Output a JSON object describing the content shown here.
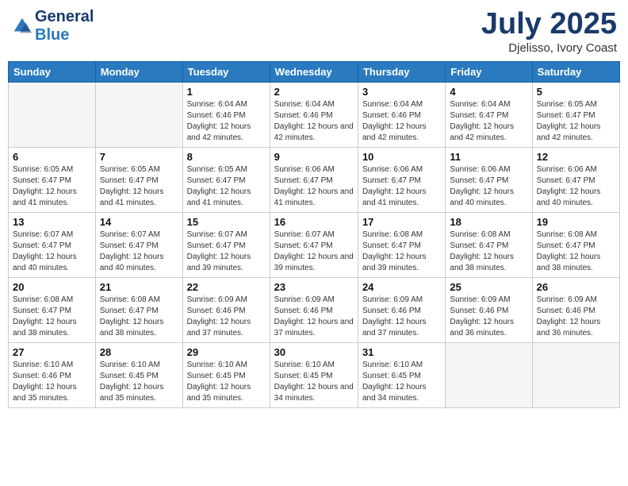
{
  "header": {
    "logo_line1": "General",
    "logo_line2": "Blue",
    "month_title": "July 2025",
    "subtitle": "Djelisso, Ivory Coast"
  },
  "days_of_week": [
    "Sunday",
    "Monday",
    "Tuesday",
    "Wednesday",
    "Thursday",
    "Friday",
    "Saturday"
  ],
  "weeks": [
    [
      {
        "day": "",
        "info": ""
      },
      {
        "day": "",
        "info": ""
      },
      {
        "day": "1",
        "info": "Sunrise: 6:04 AM\nSunset: 6:46 PM\nDaylight: 12 hours and 42 minutes."
      },
      {
        "day": "2",
        "info": "Sunrise: 6:04 AM\nSunset: 6:46 PM\nDaylight: 12 hours and 42 minutes."
      },
      {
        "day": "3",
        "info": "Sunrise: 6:04 AM\nSunset: 6:46 PM\nDaylight: 12 hours and 42 minutes."
      },
      {
        "day": "4",
        "info": "Sunrise: 6:04 AM\nSunset: 6:47 PM\nDaylight: 12 hours and 42 minutes."
      },
      {
        "day": "5",
        "info": "Sunrise: 6:05 AM\nSunset: 6:47 PM\nDaylight: 12 hours and 42 minutes."
      }
    ],
    [
      {
        "day": "6",
        "info": "Sunrise: 6:05 AM\nSunset: 6:47 PM\nDaylight: 12 hours and 41 minutes."
      },
      {
        "day": "7",
        "info": "Sunrise: 6:05 AM\nSunset: 6:47 PM\nDaylight: 12 hours and 41 minutes."
      },
      {
        "day": "8",
        "info": "Sunrise: 6:05 AM\nSunset: 6:47 PM\nDaylight: 12 hours and 41 minutes."
      },
      {
        "day": "9",
        "info": "Sunrise: 6:06 AM\nSunset: 6:47 PM\nDaylight: 12 hours and 41 minutes."
      },
      {
        "day": "10",
        "info": "Sunrise: 6:06 AM\nSunset: 6:47 PM\nDaylight: 12 hours and 41 minutes."
      },
      {
        "day": "11",
        "info": "Sunrise: 6:06 AM\nSunset: 6:47 PM\nDaylight: 12 hours and 40 minutes."
      },
      {
        "day": "12",
        "info": "Sunrise: 6:06 AM\nSunset: 6:47 PM\nDaylight: 12 hours and 40 minutes."
      }
    ],
    [
      {
        "day": "13",
        "info": "Sunrise: 6:07 AM\nSunset: 6:47 PM\nDaylight: 12 hours and 40 minutes."
      },
      {
        "day": "14",
        "info": "Sunrise: 6:07 AM\nSunset: 6:47 PM\nDaylight: 12 hours and 40 minutes."
      },
      {
        "day": "15",
        "info": "Sunrise: 6:07 AM\nSunset: 6:47 PM\nDaylight: 12 hours and 39 minutes."
      },
      {
        "day": "16",
        "info": "Sunrise: 6:07 AM\nSunset: 6:47 PM\nDaylight: 12 hours and 39 minutes."
      },
      {
        "day": "17",
        "info": "Sunrise: 6:08 AM\nSunset: 6:47 PM\nDaylight: 12 hours and 39 minutes."
      },
      {
        "day": "18",
        "info": "Sunrise: 6:08 AM\nSunset: 6:47 PM\nDaylight: 12 hours and 38 minutes."
      },
      {
        "day": "19",
        "info": "Sunrise: 6:08 AM\nSunset: 6:47 PM\nDaylight: 12 hours and 38 minutes."
      }
    ],
    [
      {
        "day": "20",
        "info": "Sunrise: 6:08 AM\nSunset: 6:47 PM\nDaylight: 12 hours and 38 minutes."
      },
      {
        "day": "21",
        "info": "Sunrise: 6:08 AM\nSunset: 6:47 PM\nDaylight: 12 hours and 38 minutes."
      },
      {
        "day": "22",
        "info": "Sunrise: 6:09 AM\nSunset: 6:46 PM\nDaylight: 12 hours and 37 minutes."
      },
      {
        "day": "23",
        "info": "Sunrise: 6:09 AM\nSunset: 6:46 PM\nDaylight: 12 hours and 37 minutes."
      },
      {
        "day": "24",
        "info": "Sunrise: 6:09 AM\nSunset: 6:46 PM\nDaylight: 12 hours and 37 minutes."
      },
      {
        "day": "25",
        "info": "Sunrise: 6:09 AM\nSunset: 6:46 PM\nDaylight: 12 hours and 36 minutes."
      },
      {
        "day": "26",
        "info": "Sunrise: 6:09 AM\nSunset: 6:46 PM\nDaylight: 12 hours and 36 minutes."
      }
    ],
    [
      {
        "day": "27",
        "info": "Sunrise: 6:10 AM\nSunset: 6:46 PM\nDaylight: 12 hours and 35 minutes."
      },
      {
        "day": "28",
        "info": "Sunrise: 6:10 AM\nSunset: 6:45 PM\nDaylight: 12 hours and 35 minutes."
      },
      {
        "day": "29",
        "info": "Sunrise: 6:10 AM\nSunset: 6:45 PM\nDaylight: 12 hours and 35 minutes."
      },
      {
        "day": "30",
        "info": "Sunrise: 6:10 AM\nSunset: 6:45 PM\nDaylight: 12 hours and 34 minutes."
      },
      {
        "day": "31",
        "info": "Sunrise: 6:10 AM\nSunset: 6:45 PM\nDaylight: 12 hours and 34 minutes."
      },
      {
        "day": "",
        "info": ""
      },
      {
        "day": "",
        "info": ""
      }
    ]
  ]
}
